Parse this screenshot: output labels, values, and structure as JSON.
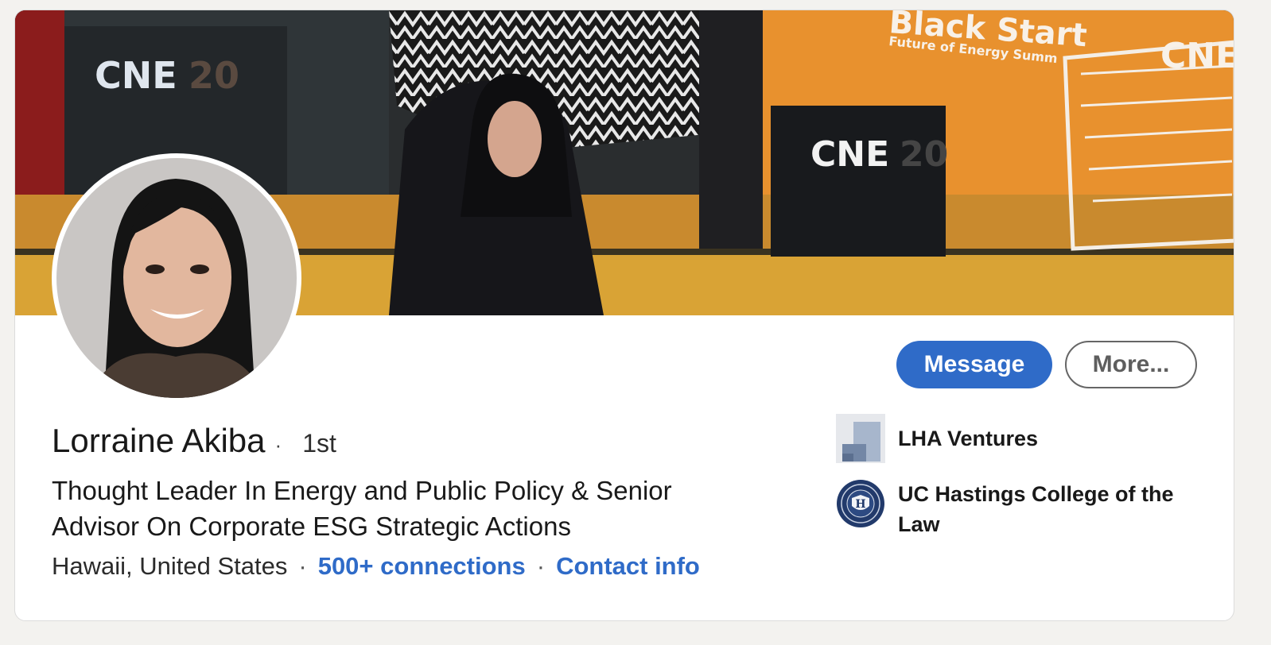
{
  "profile": {
    "name": "Lorraine Akiba",
    "degree": "1st",
    "headline": "Thought Leader In Energy and Public Policy & Senior Advisor On Corporate ESG Strategic Actions",
    "location": "Hawaii, United States",
    "connections": "500+ connections",
    "contact": "Contact info"
  },
  "actions": {
    "message_label": "Message",
    "more_label": "More..."
  },
  "banner": {
    "sign_left": "CNE",
    "sign_left_faded": "20",
    "sign_right": "CNE",
    "sign_right_faded": "20",
    "sign_far_right": "CNE",
    "event_title": "Black Start",
    "event_subtitle": "Future of Energy Summ"
  },
  "organizations": [
    {
      "name": "LHA Ventures",
      "logo": "lha-ventures-logo"
    },
    {
      "name": "UC Hastings College of the Law",
      "logo": "uc-hastings-seal",
      "seal_letter": "H"
    }
  ],
  "colors": {
    "accent": "#2f6bc8",
    "banner_orange": "#e8912e"
  }
}
